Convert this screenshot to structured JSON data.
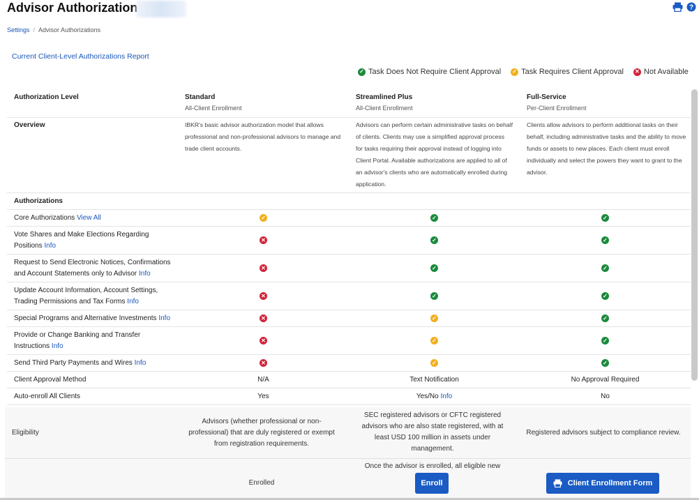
{
  "header": {
    "title": "Advisor Authorizations",
    "print_icon": "print-icon",
    "help_icon": "help-icon"
  },
  "breadcrumb": {
    "items": [
      "Settings",
      "Advisor Authorizations"
    ]
  },
  "report_link": "Current Client-Level Authorizations Report",
  "legend": {
    "items": [
      {
        "icon": "check-icon",
        "color": "#1b8a3d",
        "label": "Task Does Not Require Client Approval"
      },
      {
        "icon": "check-icon",
        "color": "#f2b01e",
        "label": "Task Requires Client Approval"
      },
      {
        "icon": "x-icon",
        "color": "#d3223a",
        "label": "Not Available"
      }
    ]
  },
  "table": {
    "header": {
      "col0": "Authorization Level",
      "cols": [
        {
          "title": "Standard",
          "sub": "All-Client Enrollment"
        },
        {
          "title": "Streamlined Plus",
          "sub": "All-Client Enrollment"
        },
        {
          "title": "Full-Service",
          "sub": "Per-Client Enrollment"
        }
      ]
    },
    "overview": {
      "label": "Overview",
      "cols": [
        "IBKR's basic advisor authorization model that allows professional and non-professional advisors to manage and trade client accounts.",
        "Advisors can perform certain administrative tasks on behalf of clients. Clients may use a simplified approval process for tasks requiring their approval instead of logging into Client Portal. Available authorizations are applied to all of an advisor's clients who are automatically enrolled during application.",
        "Clients allow advisors to perform additional tasks on their behalf, including administrative tasks and the ability to move funds or assets to new places. Each client must enroll individually and select the powers they want to grant to the advisor."
      ]
    },
    "section_label": "Authorizations",
    "auth_rows": [
      {
        "line1": "Core Authorizations",
        "line2": "",
        "link": "View All",
        "status": [
          "yellow",
          "green",
          "green"
        ]
      },
      {
        "line1": "Vote Shares and Make Elections Regarding",
        "line2": "Positions",
        "link": "Info",
        "status": [
          "red",
          "green",
          "green"
        ]
      },
      {
        "line1": "Request to Send Electronic Notices, Confirmations",
        "line2": "and Account Statements only to Advisor",
        "link": "Info",
        "status": [
          "red",
          "green",
          "green"
        ]
      },
      {
        "line1": "Update Account Information, Account Settings,",
        "line2": "Trading Permissions and Tax Forms",
        "link": "Info",
        "status": [
          "red",
          "green",
          "green"
        ]
      },
      {
        "line1": "Special Programs and Alternative Investments",
        "line2": "",
        "link": "Info",
        "status": [
          "red",
          "yellow",
          "green"
        ]
      },
      {
        "line1": "Provide or Change Banking and Transfer",
        "line2": "Instructions",
        "link": "Info",
        "status": [
          "red",
          "yellow",
          "green"
        ]
      },
      {
        "line1": "Send Third Party Payments and Wires",
        "line2": "",
        "link": "Info",
        "status": [
          "red",
          "yellow",
          "green"
        ]
      }
    ],
    "approval": {
      "label": "Client Approval Method",
      "values": [
        "N/A",
        "Text Notification",
        "No Approval Required"
      ]
    },
    "autoenroll": {
      "label": "Auto-enroll All Clients",
      "values": [
        "Yes",
        "Yes/No",
        "No"
      ],
      "link": "Info"
    }
  },
  "eligibility": {
    "label": "Eligibility",
    "cols": [
      "Advisors (whether professional or non-professional) that are duly registered or exempt from registration requirements.",
      "SEC registered advisors or CFTC registered advisors who are also state registered, with at least USD 100 million in assets under management.",
      "Registered advisors subject to compliance review."
    ]
  },
  "actions": {
    "enrolled_label": "Enrolled",
    "note": "Once the advisor is enrolled, all eligible new",
    "enroll_button": "Enroll",
    "form_button": "Client Enrollment Form"
  }
}
